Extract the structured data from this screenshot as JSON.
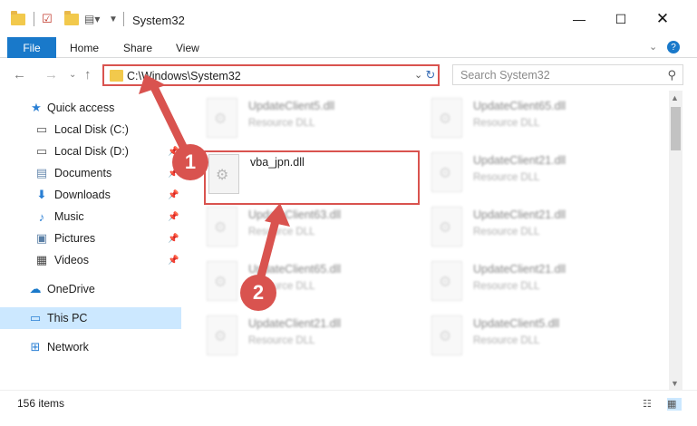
{
  "window": {
    "title": "System32",
    "controls": [
      "minimize",
      "maximize",
      "close"
    ]
  },
  "ribbon": {
    "file_label": "File",
    "tabs": [
      "Home",
      "Share",
      "View"
    ]
  },
  "address": {
    "path": "C:\\Windows\\System32",
    "search_placeholder": "Search System32"
  },
  "nav": {
    "items": [
      {
        "label": "Quick access",
        "icon": "star-icon"
      },
      {
        "label": "Local Disk (C:)",
        "icon": "drive-icon"
      },
      {
        "label": "Local Disk (D:)",
        "icon": "drive-icon"
      },
      {
        "label": "Documents",
        "icon": "documents-icon"
      },
      {
        "label": "Downloads",
        "icon": "download-icon"
      },
      {
        "label": "Music",
        "icon": "music-icon"
      },
      {
        "label": "Pictures",
        "icon": "pictures-icon"
      },
      {
        "label": "Videos",
        "icon": "videos-icon"
      },
      {
        "label": "OneDrive",
        "icon": "cloud-icon"
      },
      {
        "label": "This PC",
        "icon": "computer-icon"
      },
      {
        "label": "Network",
        "icon": "network-icon"
      }
    ]
  },
  "files": {
    "left_column": [
      {
        "name": "UpdateClient5.dll",
        "type": "Resource DLL"
      },
      {
        "name": "vba_jpn.dll",
        "type": ""
      },
      {
        "name": "UpdateClient63.dll",
        "type": "Resource DLL"
      },
      {
        "name": "UpdateClient65.dll",
        "type": "Resource DLL"
      },
      {
        "name": "UpdateClient21.dll",
        "type": "Resource DLL"
      }
    ],
    "right_column": [
      {
        "name": "UpdateClient65.dll",
        "type": "Resource DLL"
      },
      {
        "name": "UpdateClient21.dll",
        "type": "Resource DLL"
      },
      {
        "name": "UpdateClient21.dll",
        "type": "Resource DLL"
      },
      {
        "name": "UpdateClient21.dll",
        "type": "Resource DLL"
      },
      {
        "name": "UpdateClient5.dll",
        "type": "Resource DLL"
      }
    ]
  },
  "status": {
    "item_count": "156 items"
  },
  "annotations": {
    "step1": "1",
    "step2": "2",
    "color": "#d9534f"
  }
}
